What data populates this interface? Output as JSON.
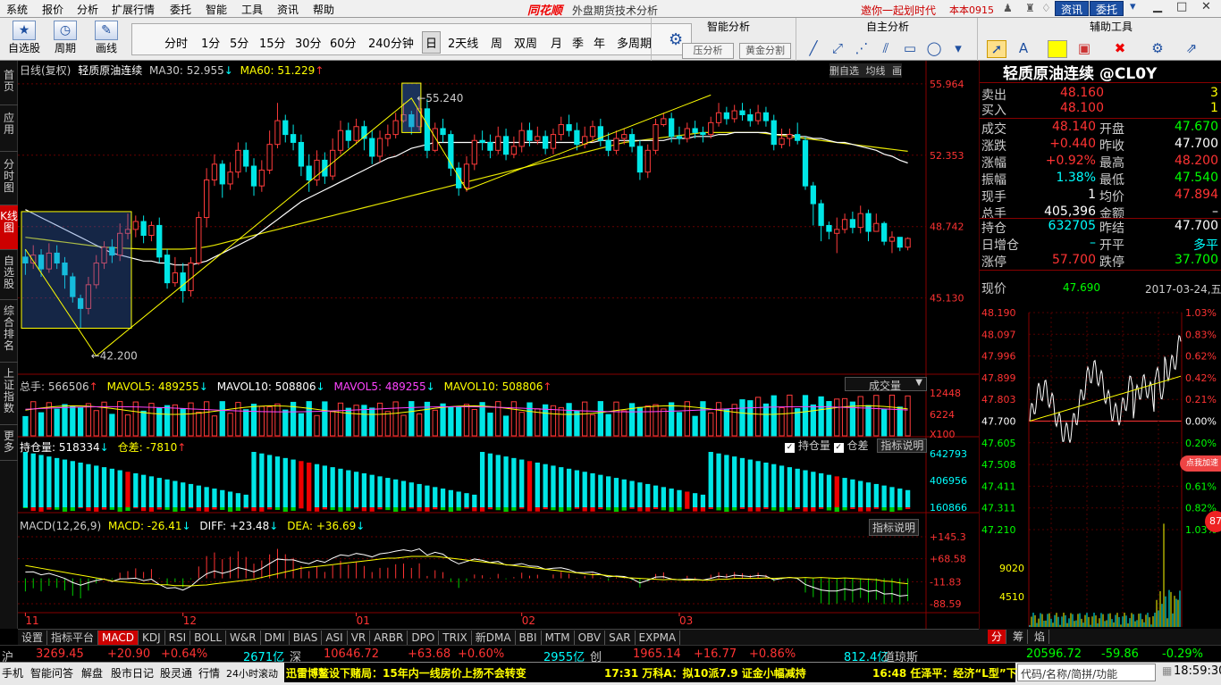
{
  "menu": {
    "items": [
      "系统",
      "报价",
      "分析",
      "扩展行情",
      "委托",
      "智能",
      "工具",
      "资讯",
      "帮助"
    ],
    "brand": "同花顺",
    "title": "外盘期货技术分析",
    "invite": "邀你一起划时代",
    "account": "本本0915",
    "btn_info": "资讯",
    "btn_trade": "委托"
  },
  "toolbar": {
    "tools": [
      {
        "label": "自选股",
        "icon": "star-icon"
      },
      {
        "label": "周期",
        "icon": "clock-icon"
      },
      {
        "label": "画线",
        "icon": "pen-icon"
      }
    ],
    "periods": [
      "分时",
      "1分",
      "5分",
      "15分",
      "30分",
      "60分",
      "240分钟",
      "日",
      "2天线",
      "周",
      "双周",
      "月",
      "季",
      "年",
      "多周期"
    ],
    "active_period": "日",
    "smart_header": "智能分析",
    "smart_buttons": [
      "压分析",
      "黄金分割"
    ],
    "self_header": "自主分析",
    "aux_header": "辅助工具"
  },
  "sidebar": [
    "首页",
    "应用",
    "分时图",
    "K线图",
    "自选股",
    "综合排名",
    "上证指数",
    "更多"
  ],
  "chart": {
    "header_name": "日线(复权)",
    "header_product": "轻质原油连续",
    "ma30": "MA30: 52.955",
    "ma60": "MA60: 51.229",
    "price_ticks": [
      "55.964",
      "52.353",
      "48.742",
      "45.130"
    ],
    "hi_label": "55.240",
    "lo_label": "42.200",
    "top_right_tabs": [
      "删自选",
      "均线",
      "画"
    ],
    "vol_header": [
      {
        "t": "总手: 566506",
        "c": "#ccc"
      },
      {
        "t": "MAVOL5: 489255",
        "c": "#ff0"
      },
      {
        "t": "MAVOL10: 508806",
        "c": "#fff"
      },
      {
        "t": "MAVOL5: 489255",
        "c": "#f4f"
      },
      {
        "t": "MAVOL10: 508806",
        "c": "#ff0"
      }
    ],
    "vol_select": "成交量",
    "vol_ticks": [
      "12448",
      "6224",
      "X100"
    ],
    "oi_header": "持仓量: 518334",
    "oi_diff": "仓差: -7810",
    "oi_checks": [
      "持仓量",
      "仓差"
    ],
    "oi_ticks": [
      "642793",
      "406956",
      "160866"
    ],
    "indicator_btn": "指标说明",
    "macd_header": "MACD(12,26,9)",
    "macd_val": "MACD: -26.41",
    "diff_val": "DIFF: +23.48",
    "dea_val": "DEA: +36.69",
    "macd_ticks": [
      "+145.3",
      "+68.58",
      "-11.83",
      "-88.59"
    ],
    "month_labels": [
      "11",
      "12",
      "01",
      "02",
      "03"
    ]
  },
  "chart_data": {
    "type": "candlestick",
    "title": "轻质原油连续",
    "ylim": [
      41.5,
      56.5
    ],
    "candles": [
      [
        47.2,
        46.9,
        47.6,
        46.3
      ],
      [
        46.9,
        47.3,
        47.8,
        46.6
      ],
      [
        47.3,
        46.6,
        47.6,
        46.2
      ],
      [
        46.6,
        47.4,
        47.9,
        46.4
      ],
      [
        47.4,
        46.9,
        47.8,
        46.6
      ],
      [
        46.9,
        46.3,
        47.2,
        45.6
      ],
      [
        46.2,
        45.2,
        46.4,
        44.9
      ],
      [
        45.1,
        44.6,
        45.3,
        43.6
      ],
      [
        44.6,
        45.8,
        46.2,
        44.3
      ],
      [
        45.8,
        46.9,
        47.3,
        45.6
      ],
      [
        46.9,
        47.7,
        48.0,
        46.6
      ],
      [
        47.7,
        47.3,
        48.1,
        46.9
      ],
      [
        47.3,
        48.4,
        48.9,
        47.0
      ],
      [
        48.4,
        48.6,
        49.4,
        48.1
      ],
      [
        48.6,
        49.0,
        49.3,
        48.2
      ],
      [
        49.0,
        48.3,
        49.3,
        47.9
      ],
      [
        48.3,
        48.8,
        49.0,
        48.0
      ],
      [
        48.8,
        47.2,
        49.2,
        46.9
      ],
      [
        47.3,
        45.9,
        47.6,
        45.6
      ],
      [
        45.9,
        46.4,
        47.2,
        45.7
      ],
      [
        46.4,
        45.5,
        46.9,
        44.9
      ],
      [
        45.5,
        46.9,
        47.2,
        45.2
      ],
      [
        46.9,
        49.2,
        49.5,
        46.8
      ],
      [
        49.2,
        51.1,
        51.7,
        48.7
      ],
      [
        51.1,
        51.9,
        52.4,
        50.8
      ],
      [
        51.9,
        50.9,
        52.1,
        50.2
      ],
      [
        50.9,
        51.5,
        52.0,
        50.6
      ],
      [
        51.5,
        52.6,
        53.0,
        51.2
      ],
      [
        52.6,
        51.8,
        53.0,
        51.5
      ],
      [
        51.8,
        50.8,
        52.2,
        50.3
      ],
      [
        50.8,
        51.6,
        52.1,
        50.5
      ],
      [
        51.6,
        52.9,
        53.6,
        51.4
      ],
      [
        52.9,
        54.1,
        55.0,
        52.7
      ],
      [
        54.1,
        53.4,
        54.4,
        53.0
      ],
      [
        53.4,
        53.0,
        53.9,
        52.6
      ],
      [
        53.0,
        51.8,
        53.4,
        51.3
      ],
      [
        51.8,
        51.1,
        52.4,
        50.5
      ],
      [
        51.1,
        52.1,
        52.6,
        50.8
      ],
      [
        52.1,
        51.3,
        52.5,
        50.9
      ],
      [
        51.3,
        52.6,
        53.2,
        51.1
      ],
      [
        52.6,
        53.6,
        54.1,
        52.4
      ],
      [
        53.6,
        53.1,
        54.0,
        52.7
      ],
      [
        53.1,
        53.8,
        54.2,
        52.9
      ],
      [
        53.8,
        53.2,
        54.1,
        52.6
      ],
      [
        53.2,
        52.3,
        53.6,
        51.9
      ],
      [
        52.3,
        53.2,
        53.6,
        52.0
      ],
      [
        53.2,
        53.4,
        53.9,
        52.8
      ],
      [
        53.4,
        54.1,
        54.5,
        53.2
      ],
      [
        54.1,
        54.4,
        55.0,
        54.0
      ],
      [
        54.4,
        53.8,
        54.6,
        53.4
      ],
      [
        53.8,
        54.7,
        55.2,
        53.6
      ],
      [
        54.7,
        52.6,
        55.2,
        52.2
      ],
      [
        52.6,
        53.7,
        54.0,
        52.5
      ],
      [
        53.7,
        53.4,
        54.2,
        53.0
      ],
      [
        53.4,
        51.7,
        53.6,
        51.3
      ],
      [
        51.7,
        50.7,
        52.0,
        50.3
      ],
      [
        50.7,
        51.9,
        52.3,
        50.5
      ],
      [
        51.9,
        53.1,
        53.4,
        51.6
      ],
      [
        53.1,
        53.0,
        53.6,
        52.6
      ],
      [
        53.0,
        52.6,
        53.4,
        52.2
      ],
      [
        52.6,
        53.3,
        53.8,
        52.4
      ],
      [
        53.3,
        52.4,
        53.7,
        52.1
      ],
      [
        52.4,
        52.8,
        53.3,
        52.2
      ],
      [
        52.8,
        53.6,
        54.0,
        52.5
      ],
      [
        53.6,
        53.1,
        54.0,
        52.8
      ],
      [
        53.1,
        53.3,
        53.8,
        52.9
      ],
      [
        53.3,
        52.7,
        53.6,
        52.4
      ],
      [
        52.7,
        53.4,
        53.7,
        52.4
      ],
      [
        53.4,
        53.9,
        54.3,
        53.1
      ],
      [
        53.9,
        53.6,
        54.4,
        53.3
      ],
      [
        53.6,
        52.9,
        54.0,
        52.6
      ],
      [
        52.9,
        53.3,
        53.8,
        52.7
      ],
      [
        53.3,
        53.8,
        54.1,
        53.0
      ],
      [
        53.8,
        53.1,
        54.2,
        52.8
      ],
      [
        53.1,
        52.6,
        53.5,
        52.3
      ],
      [
        52.6,
        53.2,
        53.6,
        52.4
      ],
      [
        53.2,
        53.4,
        53.7,
        52.9
      ],
      [
        53.4,
        52.8,
        53.7,
        52.5
      ],
      [
        52.8,
        51.5,
        53.1,
        51.1
      ],
      [
        51.5,
        52.6,
        52.9,
        51.2
      ],
      [
        52.6,
        53.9,
        54.2,
        52.4
      ],
      [
        53.9,
        54.2,
        54.5,
        53.8
      ],
      [
        54.2,
        53.3,
        54.5,
        53.0
      ],
      [
        53.3,
        53.2,
        53.8,
        52.9
      ],
      [
        53.2,
        53.7,
        54.0,
        53.0
      ],
      [
        53.7,
        53.5,
        54.1,
        53.2
      ],
      [
        53.5,
        53.4,
        53.8,
        53.0
      ],
      [
        53.4,
        54.0,
        54.3,
        53.2
      ],
      [
        54.0,
        54.5,
        55.0,
        53.8
      ],
      [
        54.5,
        54.2,
        54.8,
        53.9
      ],
      [
        54.2,
        54.6,
        54.9,
        54.0
      ],
      [
        54.6,
        54.4,
        55.0,
        54.1
      ],
      [
        54.4,
        54.1,
        54.7,
        53.8
      ],
      [
        54.1,
        54.5,
        54.9,
        53.9
      ],
      [
        54.5,
        54.1,
        54.8,
        53.8
      ],
      [
        54.1,
        52.9,
        54.4,
        52.6
      ],
      [
        52.9,
        53.2,
        53.7,
        52.7
      ],
      [
        53.2,
        53.4,
        53.7,
        52.8
      ],
      [
        53.4,
        53.1,
        54.0,
        52.9
      ],
      [
        53.1,
        50.8,
        53.3,
        50.6
      ],
      [
        50.8,
        49.9,
        51.0,
        48.8
      ],
      [
        49.9,
        48.8,
        50.1,
        48.0
      ],
      [
        48.8,
        48.5,
        49.0,
        48.1
      ],
      [
        48.4,
        48.6,
        49.2,
        47.4
      ],
      [
        48.6,
        49.1,
        49.4,
        48.4
      ],
      [
        49.1,
        48.7,
        49.5,
        48.4
      ],
      [
        48.7,
        49.4,
        49.8,
        48.4
      ],
      [
        49.4,
        48.5,
        49.6,
        48.0
      ],
      [
        48.5,
        48.9,
        49.4,
        48.6
      ],
      [
        48.9,
        48.0,
        49.0,
        47.8
      ],
      [
        48.0,
        48.2,
        48.5,
        47.4
      ],
      [
        48.2,
        47.7,
        48.2,
        47.5
      ],
      [
        47.7,
        48.14,
        48.2,
        47.54
      ]
    ],
    "ma30": [
      49.6,
      49.4,
      49.2,
      49.0,
      48.8,
      48.6,
      48.4,
      48.2,
      48.0,
      47.8,
      47.6,
      47.4,
      47.3,
      47.2,
      47.1,
      47.0,
      47.0,
      46.9,
      46.9,
      46.8,
      46.8,
      46.8,
      46.9,
      47.0,
      47.2,
      47.4,
      47.6,
      47.8,
      48.0,
      48.2,
      48.5,
      48.8,
      49.1,
      49.4,
      49.7,
      50.0,
      50.2,
      50.4,
      50.6,
      50.8,
      51.0,
      51.2,
      51.4,
      51.6,
      51.8,
      52.0,
      52.2,
      52.3,
      52.5,
      52.7,
      52.8,
      52.9,
      53.0,
      53.0,
      53.0,
      53.0,
      53.0,
      53.0,
      53.0,
      53.0,
      53.0,
      53.0,
      53.0,
      53.0,
      53.0,
      53.0,
      53.0,
      53.0,
      53.0,
      53.0,
      53.0,
      53.0,
      53.0,
      53.1,
      53.1,
      53.1,
      53.1,
      53.1,
      53.1,
      53.1,
      53.1,
      53.1,
      53.2,
      53.2,
      53.2,
      53.3,
      53.3,
      53.3,
      53.4,
      53.4,
      53.5,
      53.5,
      53.5,
      53.5,
      53.5,
      53.4,
      53.4,
      53.4,
      53.3,
      53.3,
      53.2,
      53.2,
      53.1,
      53.0,
      53.0,
      52.9,
      52.8,
      52.7,
      52.6,
      52.4,
      52.3,
      52.1,
      51.96
    ],
    "ma60": [
      48.2,
      48.15,
      48.1,
      48.05,
      48.0,
      47.95,
      47.9,
      47.85,
      47.8,
      47.75,
      47.7,
      47.68,
      47.66,
      47.64,
      47.62,
      47.6,
      47.6,
      47.6,
      47.6,
      47.6,
      47.6,
      47.62,
      47.66,
      47.72,
      47.8,
      47.9,
      48.0,
      48.1,
      48.2,
      48.3,
      48.4,
      48.5,
      48.6,
      48.7,
      48.8,
      48.9,
      49.0,
      49.1,
      49.2,
      49.3,
      49.4,
      49.5,
      49.6,
      49.7,
      49.8,
      49.9,
      50.0,
      50.1,
      50.2,
      50.3,
      50.4,
      50.5,
      50.6,
      50.7,
      50.8,
      50.9,
      51.0,
      51.1,
      51.2,
      51.3,
      51.4,
      51.5,
      51.6,
      51.7,
      51.8,
      51.9,
      52.0,
      52.1,
      52.2,
      52.3,
      52.4,
      52.5,
      52.6,
      52.7,
      52.8,
      52.9,
      53.0,
      53.05,
      53.1,
      53.15,
      53.2,
      53.25,
      53.3,
      53.35,
      53.4,
      53.45,
      53.5,
      53.5,
      53.5,
      53.5,
      53.5,
      53.5,
      53.5,
      53.5,
      53.45,
      53.4,
      53.35,
      53.3,
      53.25,
      53.2,
      53.15,
      53.1,
      53.05,
      53.0,
      52.95,
      52.9,
      52.85,
      52.8,
      52.75,
      52.7,
      52.65,
      52.6,
      52.55
    ],
    "volume_ticks": [
      12448,
      6224
    ],
    "oi_ticks": [
      642793,
      406956,
      160866
    ],
    "macd_ticks": [
      145.3,
      68.58,
      -11.83,
      -88.59
    ],
    "hi": 55.24,
    "lo": 42.2
  },
  "quote": {
    "title": "轻质原油连续 @CL0Y",
    "sell_label": "卖出",
    "sell_price": "48.160",
    "sell_vol": "3",
    "buy_label": "买入",
    "buy_price": "48.100",
    "buy_vol": "1",
    "rows": [
      {
        "l1": "成交",
        "v1": "48.140",
        "c1": "#f33",
        "l2": "开盘",
        "v2": "47.670",
        "c2": "#0f0"
      },
      {
        "l1": "涨跌",
        "v1": "+0.440",
        "c1": "#f33",
        "l2": "昨收",
        "v2": "47.700",
        "c2": "#fff"
      },
      {
        "l1": "涨幅",
        "v1": "+0.92%",
        "c1": "#f33",
        "l2": "最高",
        "v2": "48.200",
        "c2": "#f33"
      },
      {
        "l1": "振幅",
        "v1": "1.38%",
        "c1": "#0ff",
        "l2": "最低",
        "v2": "47.540",
        "c2": "#0f0"
      },
      {
        "l1": "现手",
        "v1": "1",
        "c1": "#fff",
        "l2": "均价",
        "v2": "47.894",
        "c2": "#f33"
      },
      {
        "l1": "总手",
        "v1": "405,396",
        "c1": "#fff",
        "l2": "金额",
        "v2": "–",
        "c2": "#fff"
      }
    ],
    "rows2": [
      {
        "l1": "持仓",
        "v1": "632705",
        "c1": "#0ff",
        "l2": "昨结",
        "v2": "47.700",
        "c2": "#fff"
      },
      {
        "l1": "日增仓",
        "v1": "–",
        "c1": "#0ff",
        "l2": "开平",
        "v2": "多平",
        "c2": "#0ff"
      },
      {
        "l1": "涨停",
        "v1": "57.700",
        "c1": "#f33",
        "l2": "跌停",
        "v2": "37.700",
        "c2": "#0f0"
      }
    ],
    "now_label": "现价",
    "now_price": "47.690",
    "date": "2017-03-24,五",
    "intraday_left": [
      "48.190",
      "48.097",
      "47.996",
      "47.899",
      "47.803",
      "47.700",
      "47.605",
      "47.508",
      "47.411",
      "47.311",
      "47.210"
    ],
    "intraday_right": [
      "1.03%",
      "0.83%",
      "0.62%",
      "0.42%",
      "0.21%",
      "0.00%",
      "0.20%",
      "",
      "0.61%",
      "0.82%",
      "1.03%"
    ],
    "intraday_vol": [
      "9020",
      "4510"
    ],
    "badge": "点我加速",
    "badge_num": "87",
    "tabs": [
      "分",
      "筹",
      "焰"
    ]
  },
  "bottom_tabs": [
    "设置",
    "指标平台",
    "MACD",
    "KDJ",
    "RSI",
    "BOLL",
    "W&R",
    "DMI",
    "BIAS",
    "ASI",
    "VR",
    "ARBR",
    "DPO",
    "TRIX",
    "新DMA",
    "BBI",
    "MTM",
    "OBV",
    "SAR",
    "EXPMA"
  ],
  "active_tab": "MACD",
  "index_bar": [
    {
      "t": "沪",
      "c": "#ccc"
    },
    {
      "t": "3269.45",
      "c": "#f33"
    },
    {
      "t": "+20.90",
      "c": "#f33"
    },
    {
      "t": "+0.64%",
      "c": "#f33"
    },
    {
      "t": "2671亿",
      "c": "#0ff"
    },
    {
      "t": "深",
      "c": "#ccc"
    },
    {
      "t": "10646.72",
      "c": "#f33"
    },
    {
      "t": "+63.68",
      "c": "#f33"
    },
    {
      "t": "+0.60%",
      "c": "#f33"
    },
    {
      "t": "2955亿",
      "c": "#0ff"
    },
    {
      "t": "创",
      "c": "#ccc"
    },
    {
      "t": "1965.14",
      "c": "#f33"
    },
    {
      "t": "+16.77",
      "c": "#f33"
    },
    {
      "t": "+0.86%",
      "c": "#f33"
    },
    {
      "t": "812.4亿",
      "c": "#0ff"
    },
    {
      "t": "道琼斯",
      "c": "#ccc"
    },
    {
      "t": "20596.72",
      "c": "#0f0"
    },
    {
      "t": "-59.86",
      "c": "#0f0"
    },
    {
      "t": "-0.29%",
      "c": "#0f0"
    }
  ],
  "status": {
    "items": [
      "手机",
      "智能问答",
      "解盘",
      "股市日记",
      "股灵通",
      "行情",
      "24小时滚动"
    ],
    "news1": "迅雷博鳌设下赌局：15年内一线房价上扬不会转变",
    "news2": "17:31 万科A：拟10派7.9 证金小幅减持",
    "news3": "16:48 任泽平：经济“L型”下",
    "search": "代码/名称/简拼/功能",
    "time": "18:59:30"
  }
}
